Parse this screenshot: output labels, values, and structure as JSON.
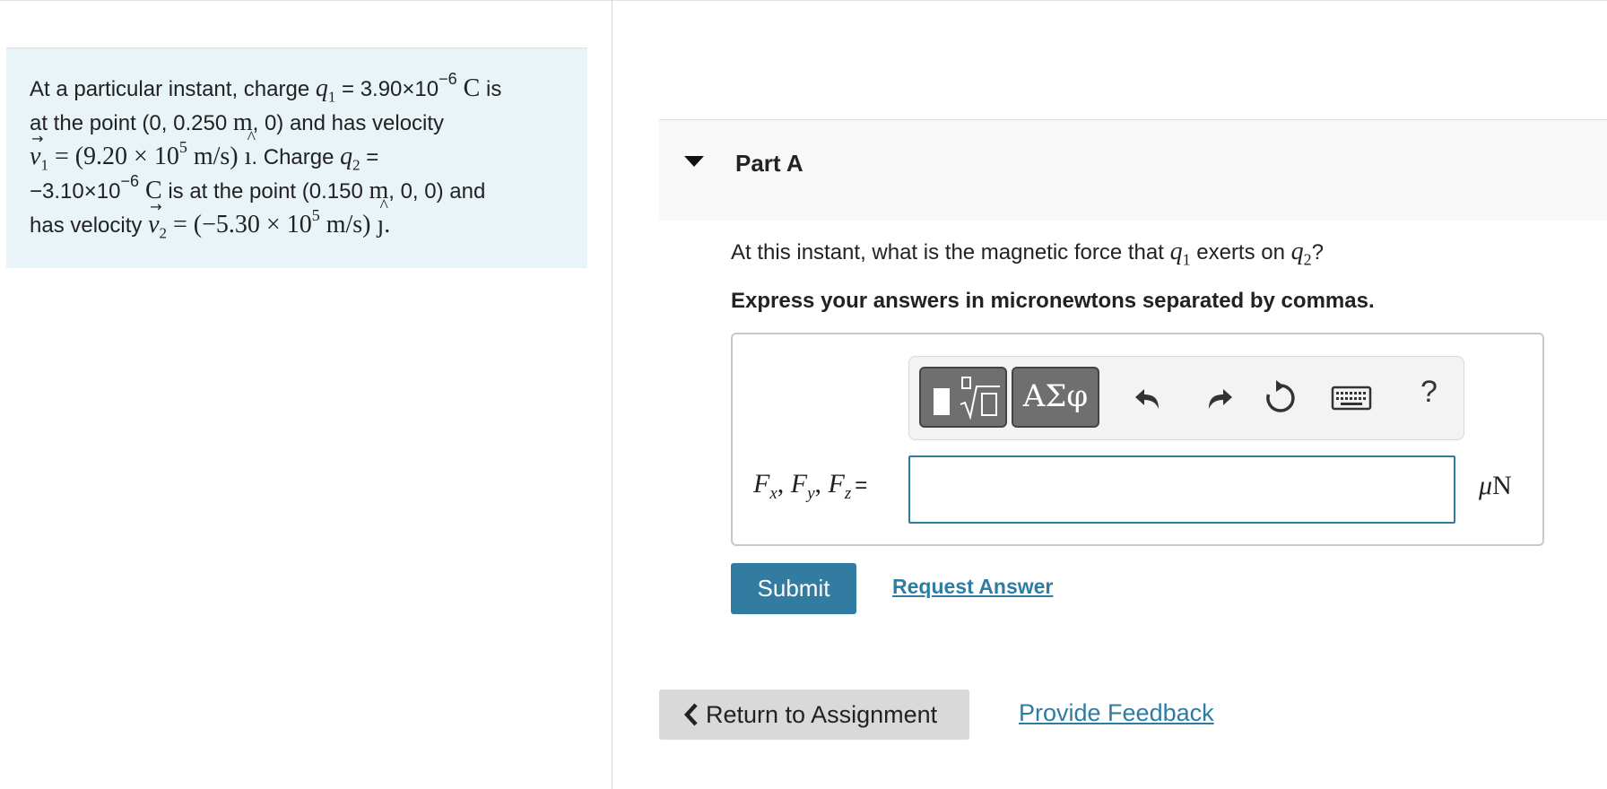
{
  "problem": {
    "line1_pre": "At a particular instant, charge ",
    "q1_sym": "q",
    "q1_sub": "1",
    "line1_eq": " = 3.90×10",
    "line1_exp": "−6",
    "line1_unit": " C",
    "line1_post": " is",
    "line2_pre": "at the point (0, 0.250 ",
    "line2_unit": "m",
    "line2_post": ", 0) and has velocity",
    "line3_v1_sym": "v",
    "line3_v1_sub": "1",
    "line3_eq_a": " = (9.20 × 10",
    "line3_exp": "5",
    "line3_eq_b": " m/s) ",
    "line3_i": "ı",
    "line3_post": ". Charge ",
    "q2_sym": "q",
    "q2_sub": "2",
    "line3_end": " =",
    "line4_pre": "−3.10×10",
    "line4_exp": "−6",
    "line4_unit": " C",
    "line4_mid": " is at the point (0.150 ",
    "line4_m": "m",
    "line4_post": ", 0, 0) and",
    "line5_pre": "has velocity ",
    "line5_v2_sym": "v",
    "line5_v2_sub": "2",
    "line5_eq_a": " = (−5.30 × 10",
    "line5_exp": "5",
    "line5_eq_b": " m/s) ",
    "line5_j": "ȷ",
    "line5_end": "."
  },
  "part": {
    "title": "Part A",
    "question_pre": "At this instant, what is the magnetic force that ",
    "q1_sym": "q",
    "q1_sub": "1",
    "question_mid": " exerts on ",
    "q2_sym": "q",
    "q2_sub": "2",
    "question_end": "?",
    "instruction": "Express your answers in micronewtons separated by commas."
  },
  "toolbar": {
    "symbols_label": "ΑΣφ",
    "icons": [
      "templates-icon",
      "symbols-icon",
      "undo-icon",
      "redo-icon",
      "reset-icon",
      "keyboard-icon",
      "help-icon"
    ],
    "help_label": "?"
  },
  "answer": {
    "var_F": "F",
    "sub_x": "x",
    "sub_y": "y",
    "sub_z": "z",
    "sep": ", ",
    "equals": "=",
    "value": "",
    "unit_mu": "μ",
    "unit_N": "N"
  },
  "actions": {
    "submit_label": "Submit",
    "request_label": "Request Answer",
    "return_label": "Return to Assignment",
    "feedback_label": "Provide Feedback"
  },
  "colors": {
    "problem_bg": "#e8f4f7",
    "accent": "#327ca1",
    "link": "#2e7ca2",
    "input_border": "#2f7ca0",
    "toolbar_button": "#6f6f6f"
  }
}
